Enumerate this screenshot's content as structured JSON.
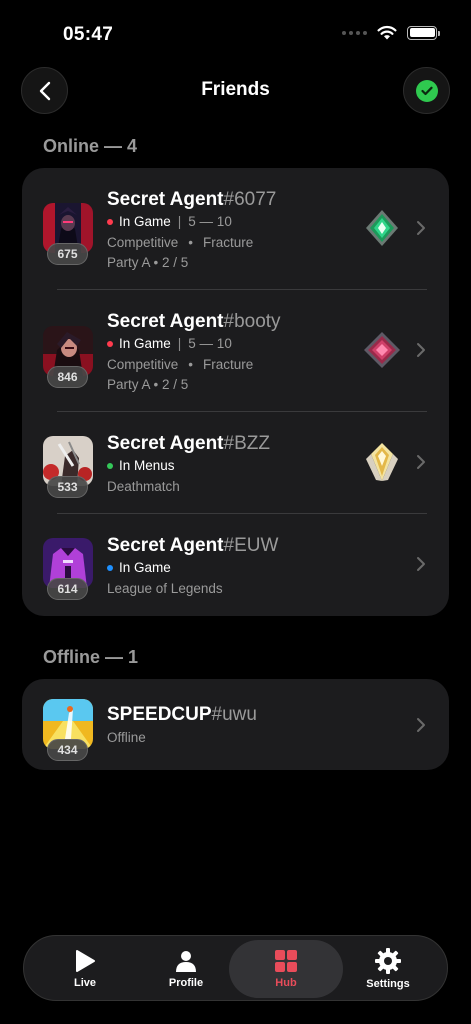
{
  "status_bar": {
    "time": "05:47"
  },
  "nav": {
    "title": "Friends"
  },
  "sections": {
    "online": {
      "title": "Online — 4"
    },
    "offline": {
      "title": "Offline — 1"
    }
  },
  "friends": [
    {
      "name": "Secret Agent",
      "tag": "#6077",
      "level": "675",
      "status": "In Game",
      "status_color": "#ff3b4e",
      "score": "5 — 10",
      "mode": "Competitive",
      "map": "Fracture",
      "party": "Party A • 2 / 5",
      "rank_icon": "ascendant-rank-icon"
    },
    {
      "name": "Secret Agent",
      "tag": "#booty",
      "level": "846",
      "status": "In Game",
      "status_color": "#ff3b4e",
      "score": "5 — 10",
      "mode": "Competitive",
      "map": "Fracture",
      "party": "Party A • 2 / 5",
      "rank_icon": "immortal-rank-icon"
    },
    {
      "name": "Secret Agent",
      "tag": "#BZZ",
      "level": "533",
      "status": "In Menus",
      "status_color": "#34c759",
      "detail": "Deathmatch",
      "rank_icon": "radiant-rank-icon"
    },
    {
      "name": "Secret Agent",
      "tag": "#EUW",
      "level": "614",
      "status": "In Game",
      "status_color": "#1e90ff",
      "detail": "League of Legends"
    }
  ],
  "offline_friends": [
    {
      "name": "SPEEDCUP",
      "tag": "#uwu",
      "level": "434",
      "status": "Offline"
    }
  ],
  "tab_bar": {
    "live": "Live",
    "profile": "Profile",
    "hub": "Hub",
    "settings": "Settings",
    "active": "hub",
    "accent": "#e84c5a"
  }
}
